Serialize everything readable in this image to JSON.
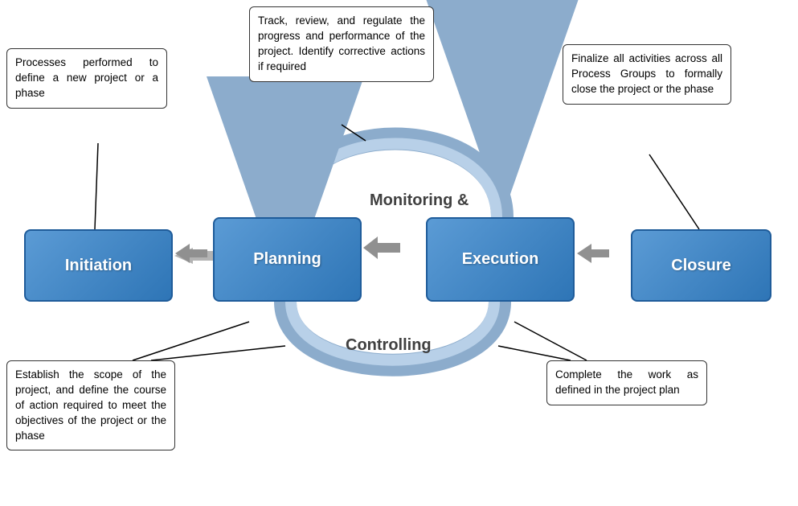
{
  "boxes": {
    "initiation": {
      "label": "Initiation"
    },
    "planning": {
      "label": "Planning"
    },
    "execution": {
      "label": "Execution"
    },
    "closure": {
      "label": "Closure"
    }
  },
  "labels": {
    "monitoring": "Monitoring &",
    "controlling": "Controlling"
  },
  "callouts": {
    "initiation_top": "Processes performed to define a new project or a phase",
    "monitoring": "Track, review, and regulate the progress and performance of the project. Identify corrective actions if required",
    "closure_top": "Finalize all activities across all Process Groups to formally close the project or the phase",
    "planning_bottom": "Establish the scope of the project, and define the course of action required to meet the objectives of the project or the phase",
    "execution_bottom": "Complete the work as defined in the project plan"
  }
}
